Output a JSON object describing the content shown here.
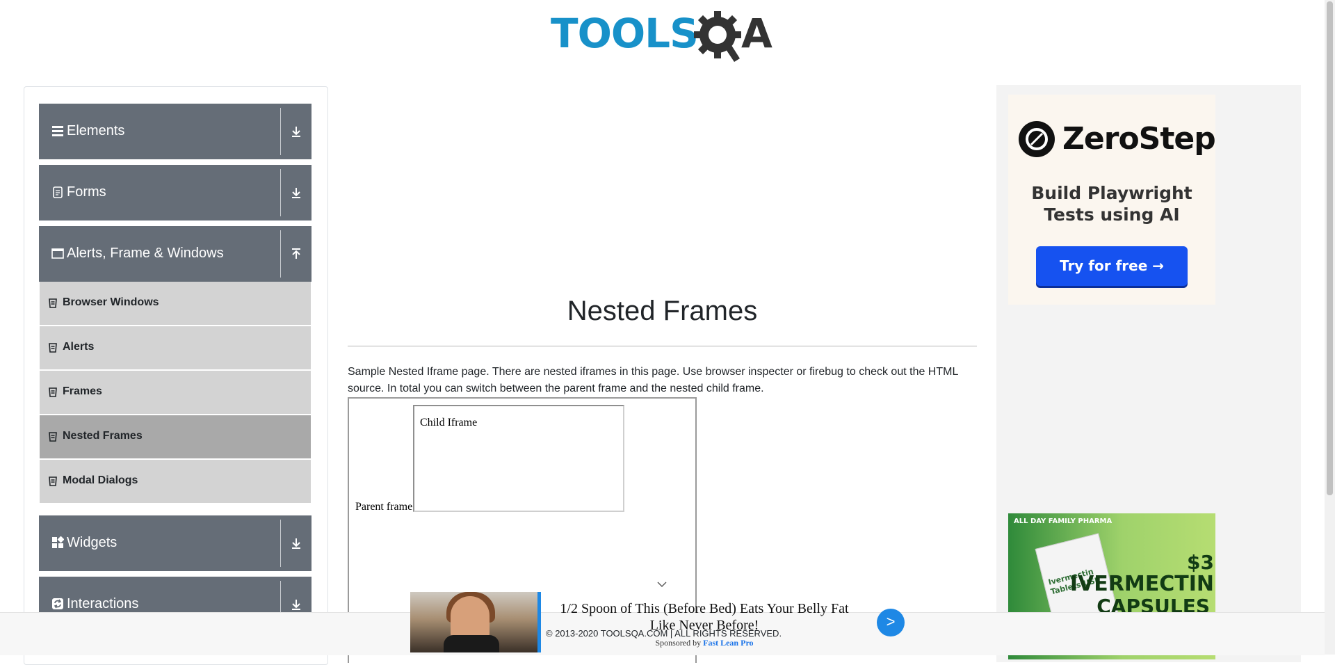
{
  "logo": {
    "text_tools": "TOOLS",
    "text_a": "A"
  },
  "sidebar": {
    "groups": [
      {
        "label": "Elements",
        "icon": "hamburger-icon",
        "state": "collapsed"
      },
      {
        "label": "Forms",
        "icon": "document-icon",
        "state": "collapsed"
      },
      {
        "label": "Alerts, Frame & Windows",
        "icon": "window-icon",
        "state": "expanded"
      },
      {
        "label": "Widgets",
        "icon": "widgets-icon",
        "state": "collapsed"
      },
      {
        "label": "Interactions",
        "icon": "interactions-icon",
        "state": "collapsed"
      }
    ],
    "items": [
      {
        "label": "Browser Windows",
        "active": false
      },
      {
        "label": "Alerts",
        "active": false
      },
      {
        "label": "Frames",
        "active": false
      },
      {
        "label": "Nested Frames",
        "active": true
      },
      {
        "label": "Modal Dialogs",
        "active": false
      }
    ]
  },
  "main": {
    "title": "Nested Frames",
    "description": "Sample Nested Iframe page. There are nested iframes in this page. Use browser inspecter or firebug to check out the HTML source. In total you can switch between the parent frame and the nested child frame.",
    "parent_frame_label": "Parent frame",
    "child_frame_label": "Child Iframe"
  },
  "right_ads": {
    "zerostep": {
      "brand": "ZeroStep",
      "tagline": "Build Playwright Tests using AI",
      "cta": "Try for free →"
    },
    "pharma": {
      "brand": "ALL DAY FAMILY PHARMA",
      "box_text": "Ivermectin Tablets USP",
      "price": "$3",
      "product_line1": "IVERMECTIN",
      "product_line2": "CAPSULES"
    }
  },
  "footer": {
    "copyright": "© 2013-2020 TOOLSQA.COM | ALL RIGHTS RESERVED."
  },
  "bottom_ad": {
    "headline": "1/2 Spoon of This (Before Bed) Eats Your Belly Fat Like Never Before!",
    "sponsored_prefix": "Sponsored by",
    "sponsor": "Fast Lean Pro",
    "go_label": ">"
  },
  "colors": {
    "sidebar_group_bg": "#656d77",
    "submenu_bg": "#d3d3d3",
    "submenu_active_bg": "#a9a9a9",
    "logo_blue": "#1891c9",
    "cta_blue": "#1652f0"
  }
}
